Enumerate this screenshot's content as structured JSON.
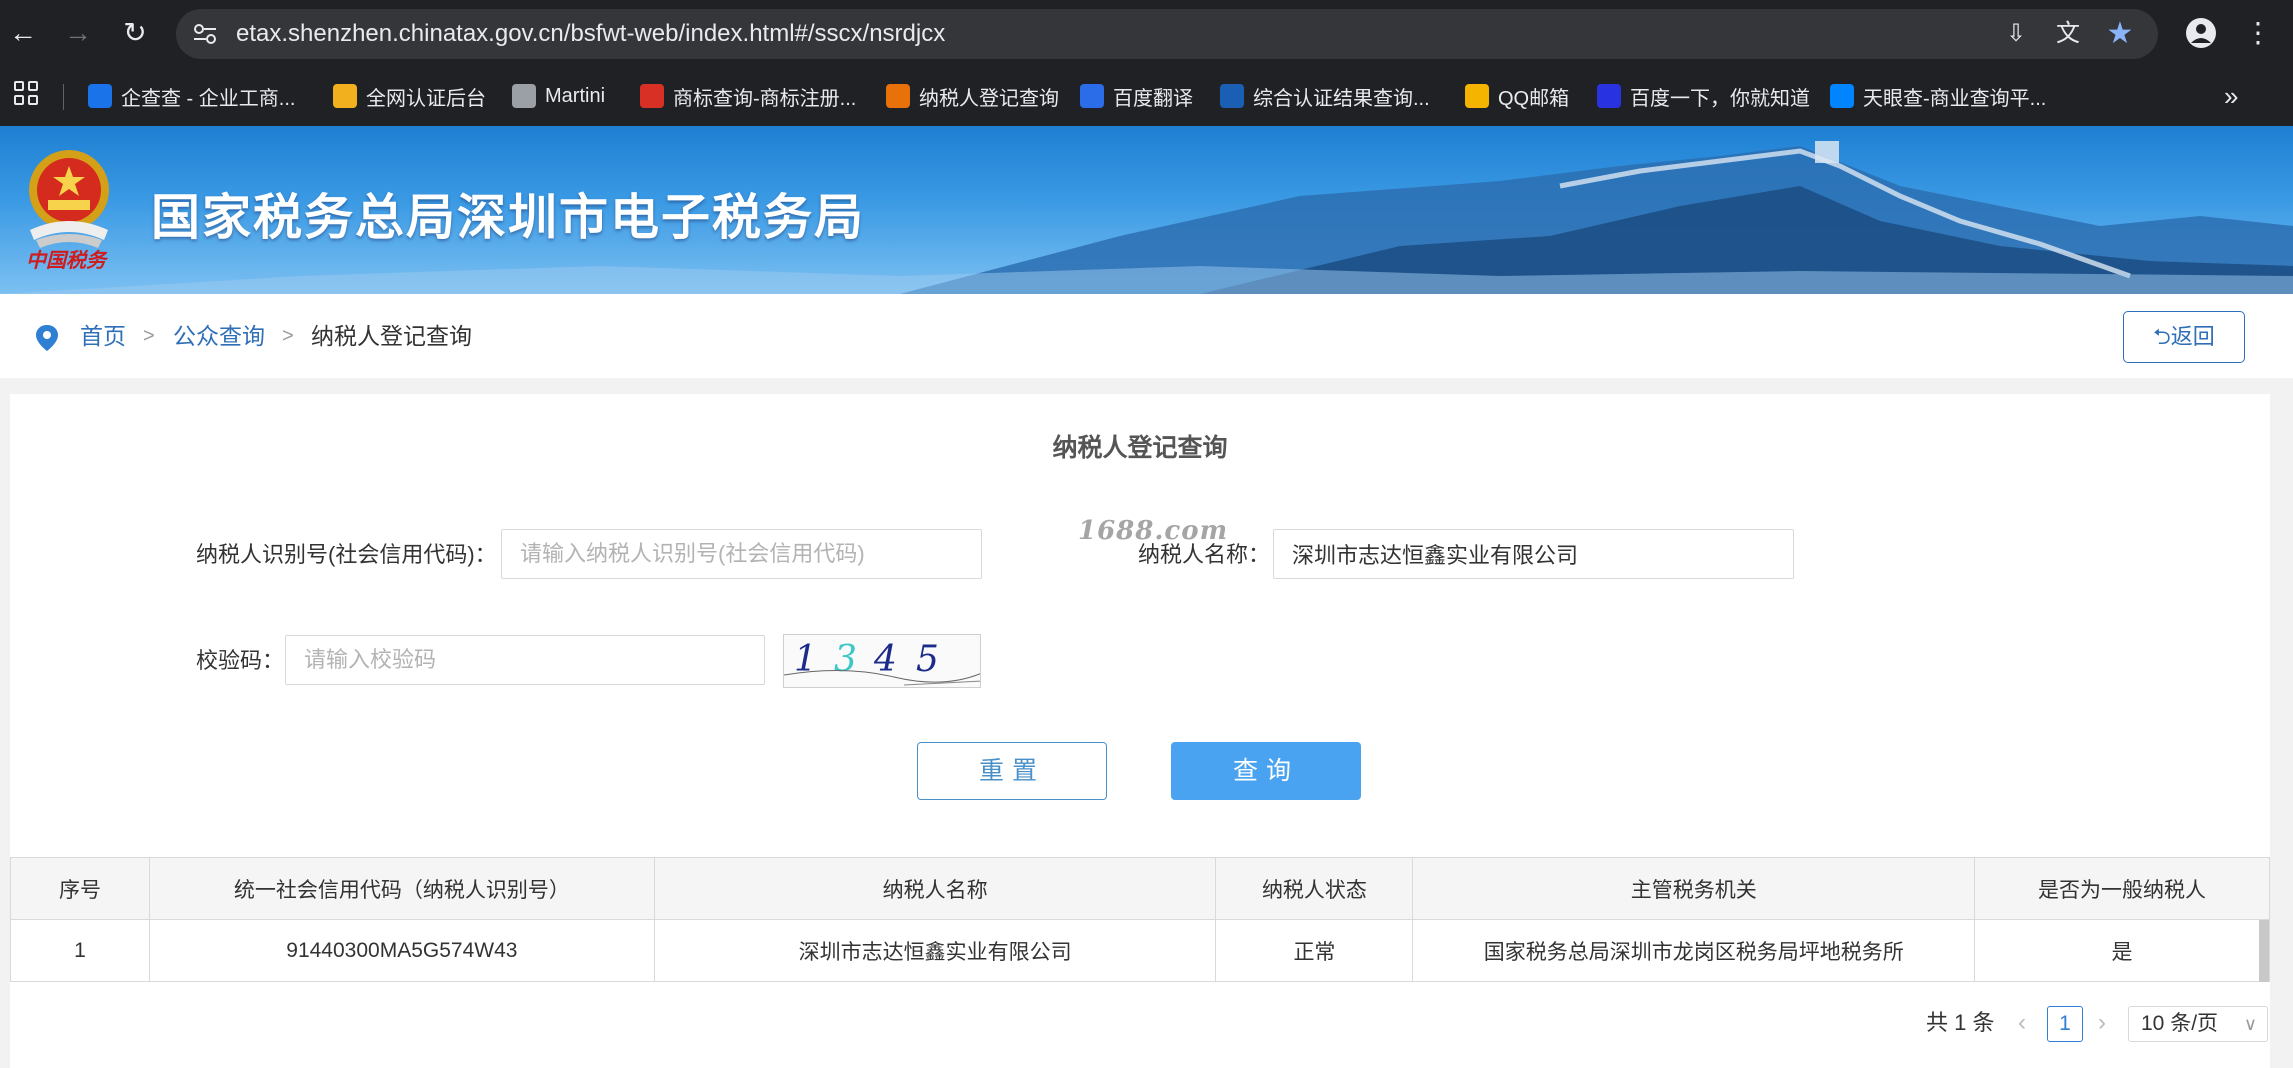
{
  "browser": {
    "url": "etax.shenzhen.chinatax.gov.cn/bsfwt-web/index.html#/sscx/nsrdjcx",
    "bookmarks": [
      {
        "label": "企查查 - 企业工商...",
        "icon": "qcc-icon",
        "color": "#1a73e8"
      },
      {
        "label": "全网认证后台",
        "icon": "auth-icon",
        "color": "#f2b01e"
      },
      {
        "label": "Martini",
        "icon": "globe-icon",
        "color": "#9aa0a6"
      },
      {
        "label": "商标查询-商标注册...",
        "icon": "trademark-icon",
        "color": "#d93025"
      },
      {
        "label": "纳税人登记查询",
        "icon": "tax-icon",
        "color": "#e8710a"
      },
      {
        "label": "百度翻译",
        "icon": "baidu-translate-icon",
        "color": "#2b6de8"
      },
      {
        "label": "综合认证结果查询...",
        "icon": "cert-icon",
        "color": "#1a5fb4"
      },
      {
        "label": "QQ邮箱",
        "icon": "qqmail-icon",
        "color": "#f4b400"
      },
      {
        "label": "百度一下，你就知道",
        "icon": "baidu-icon",
        "color": "#2932e1"
      },
      {
        "label": "天眼查-商业查询平...",
        "icon": "tianyancha-icon",
        "color": "#0084ff"
      }
    ]
  },
  "banner": {
    "title": "国家税务总局深圳市电子税务局",
    "seal_text": "中国税务"
  },
  "breadcrumb": {
    "home": "首页",
    "public_query": "公众查询",
    "current": "纳税人登记查询",
    "separator": ">",
    "back_label": "返回"
  },
  "form": {
    "title": "纳税人登记查询",
    "id_label": "纳税人识别号(社会信用代码)：",
    "id_placeholder": "请输入纳税人识别号(社会信用代码)",
    "id_value": "",
    "name_label": "纳税人名称：",
    "name_value": "深圳市志达恒鑫实业有限公司",
    "code_label": "校验码：",
    "code_placeholder": "请输入校验码",
    "captcha": [
      "1",
      "3",
      "4",
      "5"
    ],
    "watermark": "1688.com",
    "reset_label": "重置",
    "query_label": "查询"
  },
  "table": {
    "headers": [
      "序号",
      "统一社会信用代码（纳税人识别号）",
      "纳税人名称",
      "纳税人状态",
      "主管税务机关",
      "是否为一般纳税人"
    ],
    "rows": [
      [
        "1",
        "91440300MA5G574W43",
        "深圳市志达恒鑫实业有限公司",
        "正常",
        "国家税务总局深圳市龙岗区税务局坪地税务所",
        "是"
      ]
    ]
  },
  "pagination": {
    "total": "共 1 条",
    "current_page": "1",
    "page_size": "10 条/页"
  }
}
